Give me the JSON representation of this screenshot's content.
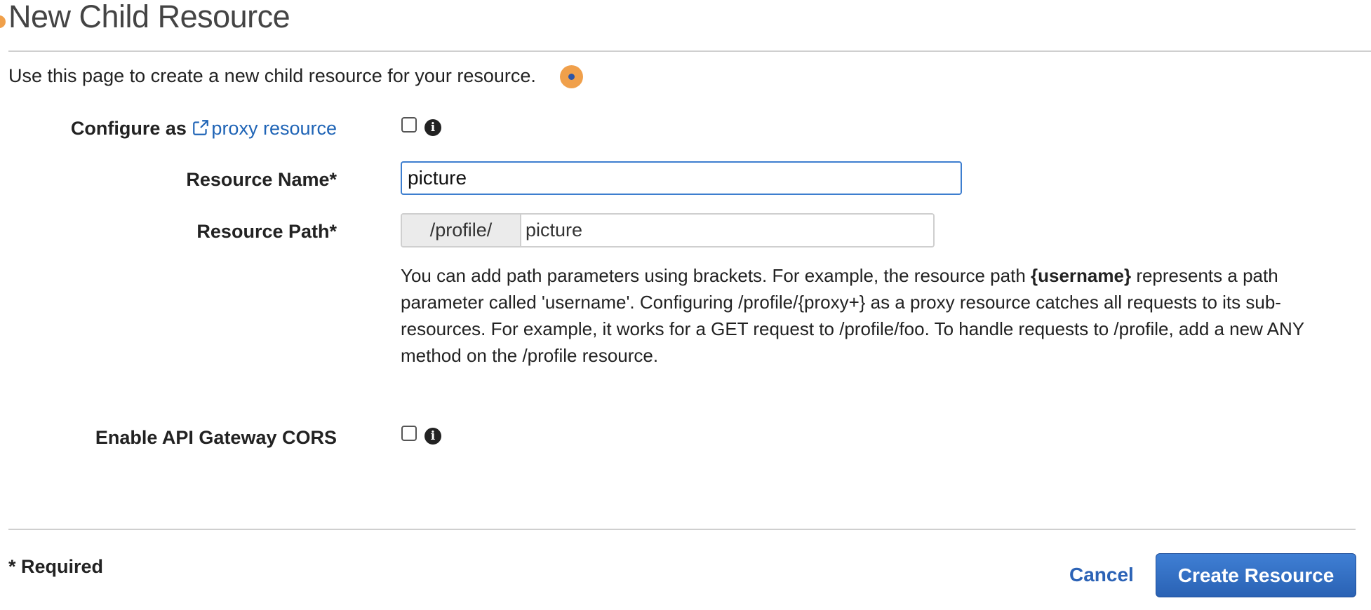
{
  "header": {
    "title": "New Child Resource",
    "intro": "Use this page to create a new child resource for your resource."
  },
  "form": {
    "proxy": {
      "label_prefix": "Configure as",
      "link_text": "proxy resource",
      "checked": false,
      "info_icon": "info-circle-icon"
    },
    "resource_name": {
      "label": "Resource Name*",
      "value": "picture"
    },
    "resource_path": {
      "label": "Resource Path*",
      "prefix": "/profile/",
      "value": "picture"
    },
    "help": {
      "part1": "You can add path parameters using brackets. For example, the resource path ",
      "bold": "{username}",
      "part2": " represents a path parameter called 'username'. Configuring /profile/{proxy+} as a proxy resource catches all requests to its sub-resources. For example, it works for a GET request to /profile/foo. To handle requests to /profile, add a new ANY method on the /profile resource."
    },
    "cors": {
      "label": "Enable API Gateway CORS",
      "checked": false,
      "info_icon": "info-circle-icon"
    }
  },
  "footer": {
    "required_note": "* Required",
    "cancel_label": "Cancel",
    "create_label": "Create Resource"
  },
  "colors": {
    "link": "#1f64b6",
    "primary_button": "#2a62b4",
    "hint_marker": "#f0a04b"
  }
}
